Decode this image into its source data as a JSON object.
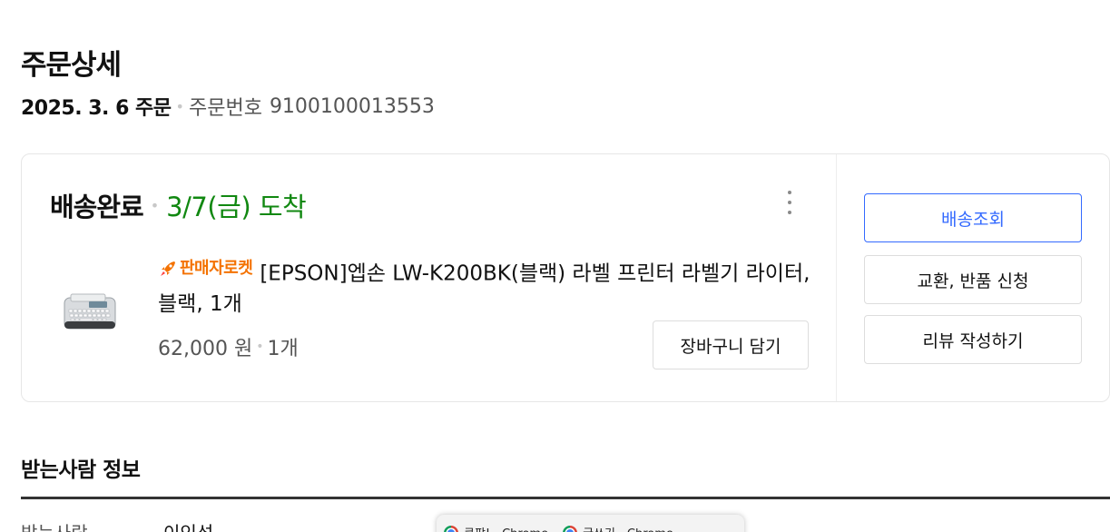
{
  "header": {
    "title": "주문상세",
    "order_date": "2025. 3. 6 주문",
    "order_number_label": "주문번호",
    "order_number": "9100100013553"
  },
  "order": {
    "status": "배송완료",
    "arrival": "3/7(금) 도착",
    "arrival_color": "#118811",
    "product": {
      "badge": "판매자로켓",
      "badge_color": "#f47200",
      "name": "[EPSON]엡손 LW-K200BK(블랙) 라벨 프린터 라벨기 라이터, 블랙, 1개",
      "price": "62,000 원",
      "quantity": "1개",
      "thumbnail_icon": "label-printer-image"
    },
    "cart_button": "장바구니 담기",
    "more_icon": "more-vertical-icon"
  },
  "side_actions": {
    "track": "배송조회",
    "exchange": "교환, 반품 신청",
    "review": "리뷰 작성하기",
    "accent_color": "#346aff"
  },
  "recipient": {
    "section_title": "받는사람 정보",
    "label": "받는사람",
    "value": "이인성"
  },
  "taskbar_popup": {
    "items": [
      {
        "label": "쿠팡! - Chrome",
        "icon": "chrome-icon"
      },
      {
        "label": "글쓰기 - Chrome",
        "icon": "chrome-icon"
      }
    ]
  }
}
